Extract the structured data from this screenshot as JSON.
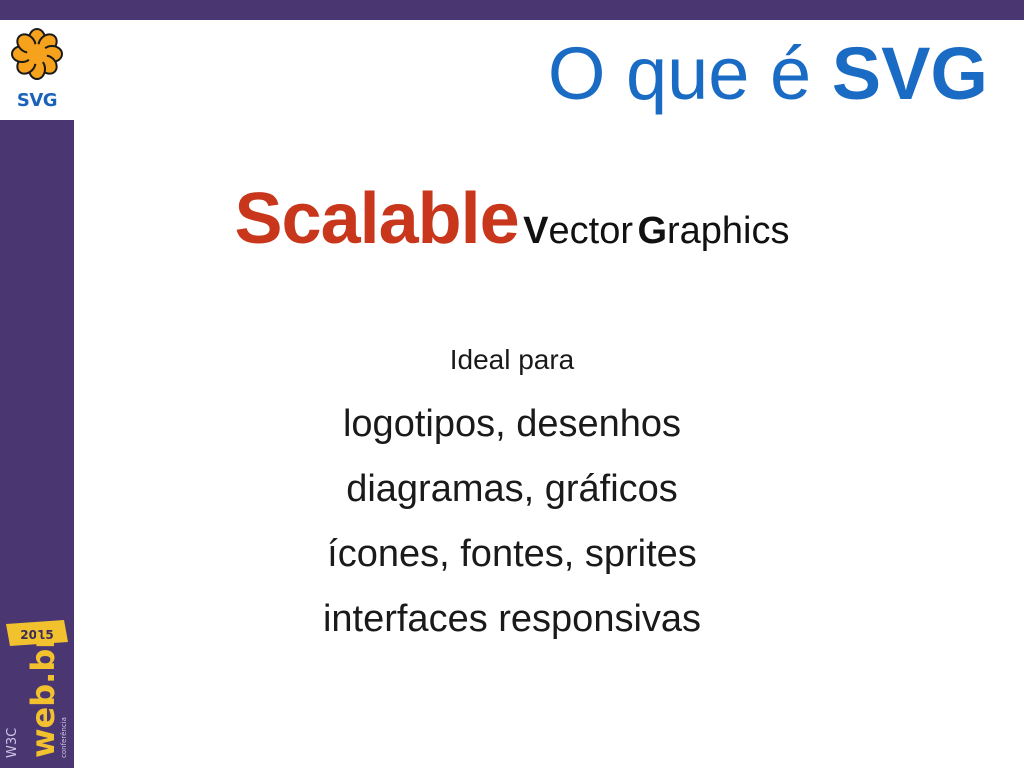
{
  "logo": {
    "icon": "svg-asterisk-icon",
    "label": "SVG",
    "color": "#f6a21c",
    "label_color": "#1a63b8"
  },
  "header": {
    "title_prefix": "O que é",
    "title_emphasis": "SVG",
    "color": "#1a6bc4"
  },
  "subtitle": {
    "word1": "Scalable",
    "word2_initial": "V",
    "word2_rest": "ector",
    "word3_initial": "G",
    "word3_rest": "raphics",
    "accent": "#c8361b"
  },
  "content": {
    "intro": "Ideal para",
    "items": [
      "logotipos, desenhos",
      "diagramas, gráficos",
      "ícones, fontes, sprites",
      "interfaces responsivas"
    ]
  },
  "event_logo": {
    "year": "2015",
    "brand": "web.br",
    "sub": "conferência",
    "badge": "W3C",
    "year_color": "#f2c22e"
  },
  "theme": {
    "bar_color": "#4a3772",
    "background": "#ffffff"
  }
}
